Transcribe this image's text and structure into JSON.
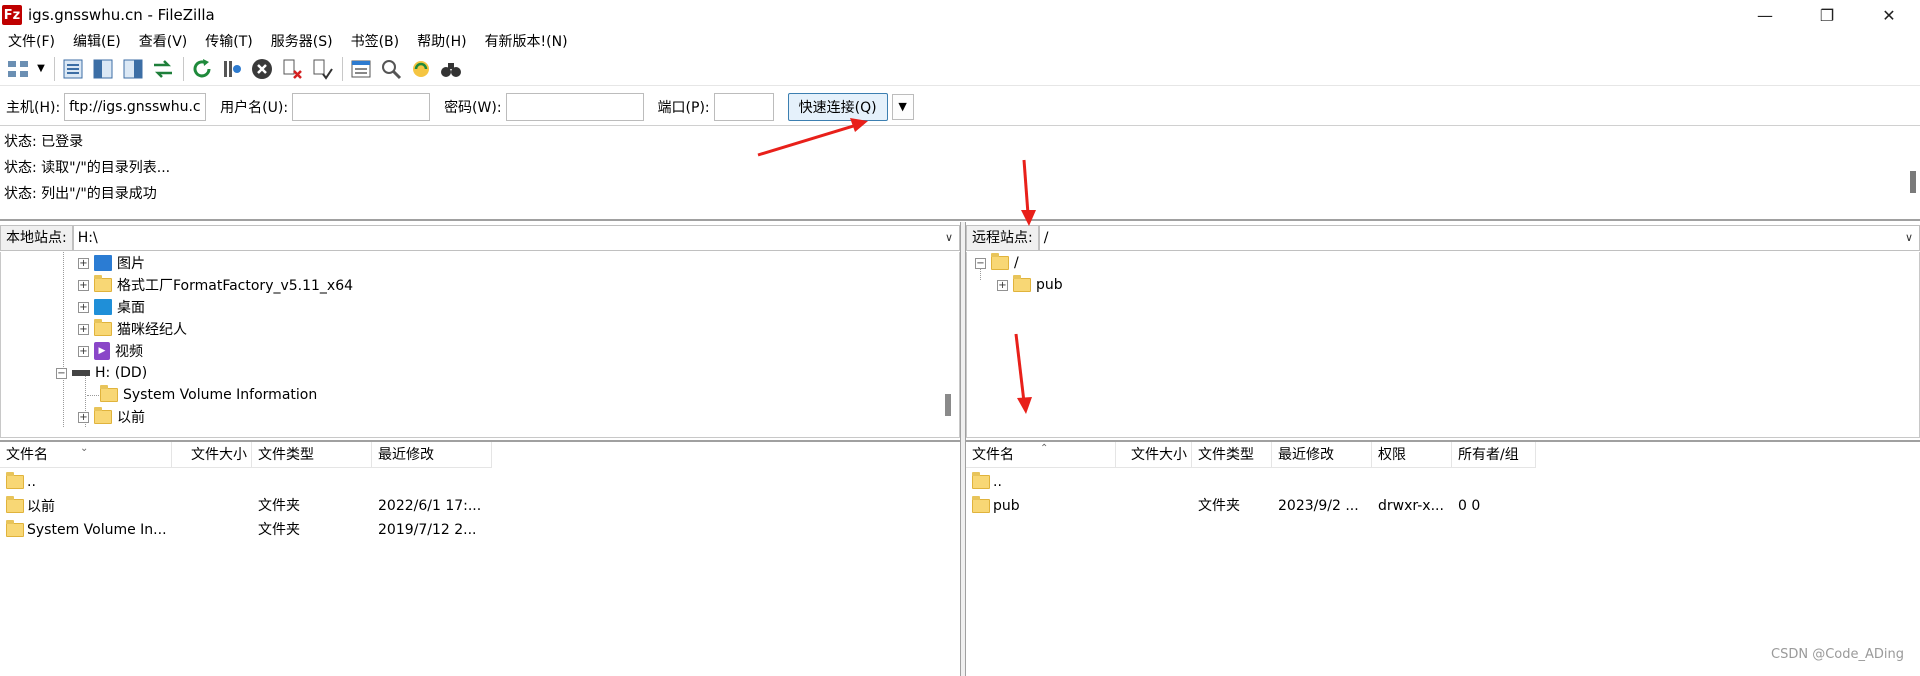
{
  "window": {
    "title": "igs.gnsswhu.cn - FileZilla",
    "app_icon_letter": "Fz",
    "controls": [
      "—",
      "❐",
      "✕"
    ]
  },
  "menu": [
    "文件(F)",
    "编辑(E)",
    "查看(V)",
    "传输(T)",
    "服务器(S)",
    "书签(B)",
    "帮助(H)",
    "有新版本!(N)"
  ],
  "quickconnect": {
    "host_label": "主机(H):",
    "host_value": "ftp://igs.gnsswhu.c",
    "user_label": "用户名(U):",
    "user_value": "",
    "pass_label": "密码(W):",
    "pass_value": "",
    "port_label": "端口(P):",
    "port_value": "",
    "connect_label": "快速连接(Q)"
  },
  "log": [
    "状态:  已登录",
    "状态:  读取\"/\"的目录列表...",
    "状态:  列出\"/\"的目录成功"
  ],
  "local": {
    "site_label": "本地站点:",
    "path": "H:\\",
    "tree": [
      {
        "label": "图片",
        "icon": "pictures-icon",
        "expandable": true
      },
      {
        "label": "格式工厂FormatFactory_v5.11_x64",
        "icon": "folder-icon",
        "expandable": true
      },
      {
        "label": "桌面",
        "icon": "desktop-icon",
        "expandable": true
      },
      {
        "label": "猫咪经纪人",
        "icon": "folder-icon",
        "expandable": true
      },
      {
        "label": "视频",
        "icon": "video-icon",
        "expandable": true
      },
      {
        "label": "H: (DD)",
        "icon": "drive-icon",
        "expandable": true
      },
      {
        "label": "System Volume Information",
        "icon": "folder-icon",
        "expandable": false
      },
      {
        "label": "以前",
        "icon": "folder-icon",
        "expandable": true
      }
    ],
    "columns": [
      "文件名",
      "文件大小",
      "文件类型",
      "最近修改"
    ],
    "rows": [
      {
        "name": "..",
        "size": "",
        "type": "",
        "modified": ""
      },
      {
        "name": "以前",
        "size": "",
        "type": "文件夹",
        "modified": "2022/6/1 17:..."
      },
      {
        "name": "System Volume In...",
        "size": "",
        "type": "文件夹",
        "modified": "2019/7/12 2..."
      }
    ]
  },
  "remote": {
    "site_label": "远程站点:",
    "path": "/",
    "tree": [
      {
        "label": "/",
        "icon": "folder-open-icon"
      },
      {
        "label": "pub",
        "icon": "folder-icon"
      }
    ],
    "columns": [
      "文件名",
      "文件大小",
      "文件类型",
      "最近修改",
      "权限",
      "所有者/组"
    ],
    "rows": [
      {
        "name": "..",
        "size": "",
        "type": "",
        "modified": "",
        "perm": "",
        "owner": ""
      },
      {
        "name": "pub",
        "size": "",
        "type": "文件夹",
        "modified": "2023/9/2 ...",
        "perm": "drwxr-x...",
        "owner": "0 0"
      }
    ]
  },
  "watermark": "CSDN @Code_ADing",
  "annotation_color": "#e8201a"
}
